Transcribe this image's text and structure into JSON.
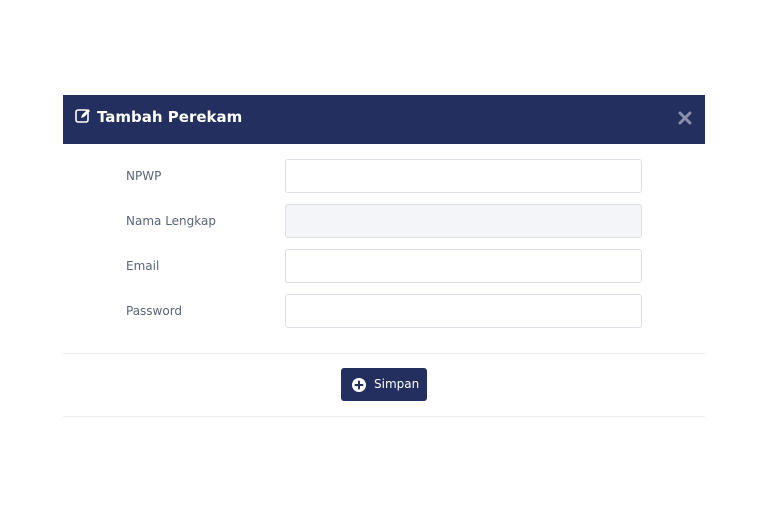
{
  "modal": {
    "title": "Tambah Perekam",
    "header_icon": "edit-icon",
    "close_icon": "close-icon",
    "colors": {
      "header_bg": "#232f5e",
      "button_bg": "#232f5e",
      "label_text": "#5a6479",
      "disabled_input_bg": "#f4f5f8"
    }
  },
  "form": {
    "npwp": {
      "label": "NPWP",
      "value": ""
    },
    "nama_lengkap": {
      "label": "Nama Lengkap",
      "value": "",
      "disabled": true
    },
    "email": {
      "label": "Email",
      "value": ""
    },
    "password": {
      "label": "Password",
      "value": ""
    }
  },
  "footer": {
    "save_label": "Simpan",
    "save_icon": "plus-circle-icon"
  }
}
